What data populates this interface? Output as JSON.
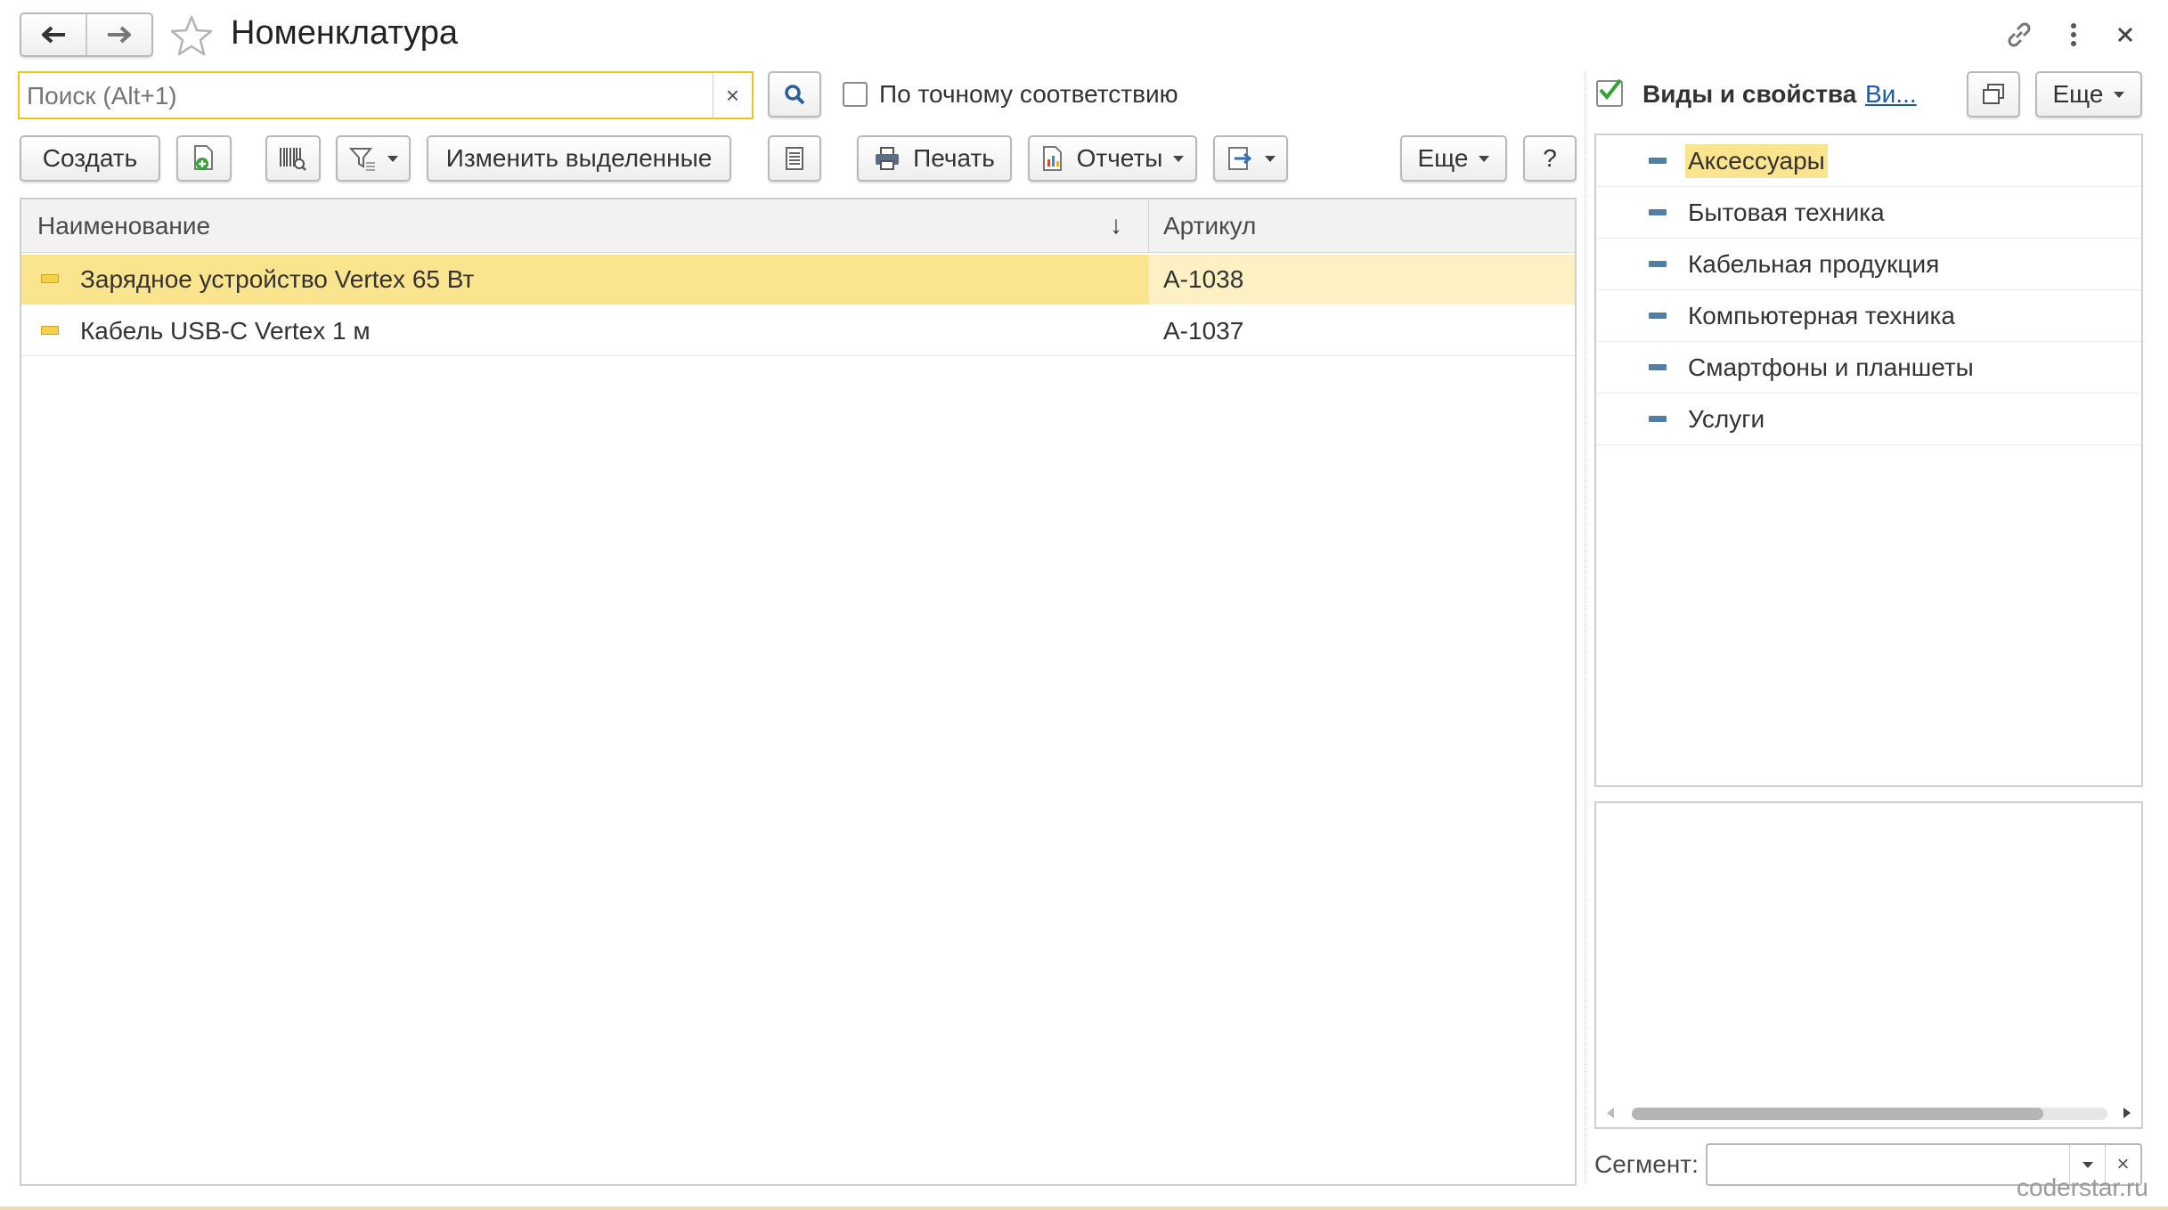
{
  "window": {
    "title": "Номенклатура",
    "back_icon": "arrow-left-icon",
    "forward_icon": "arrow-right-icon",
    "favorite_icon": "star-icon",
    "link_icon": "link-icon",
    "menu_icon": "vertical-dots-icon",
    "close_icon": "close-icon"
  },
  "search": {
    "placeholder": "Поиск (Alt+1)",
    "value": "",
    "clear_label": "×",
    "exact_match_label": "По точному соответствию",
    "exact_match_checked": false
  },
  "toolbar": {
    "create_label": "Создать",
    "change_selected_label": "Изменить выделенные",
    "print_label": "Печать",
    "reports_label": "Отчеты",
    "more_label": "Еще",
    "help_label": "?"
  },
  "table": {
    "columns": [
      "Наименование",
      "Артикул"
    ],
    "sort_indicator": "↓",
    "rows": [
      {
        "name": "Зарядное устройство Vertex 65 Вт",
        "sku": "А-1038",
        "selected": true
      },
      {
        "name": "Кабель USB-C Vertex 1 м",
        "sku": "А-1037",
        "selected": false
      }
    ]
  },
  "side_panel": {
    "checkbox_checked": true,
    "title": "Виды и свойства",
    "link": "Ви...",
    "more_label": "Еще",
    "items": [
      {
        "label": "Аксессуары",
        "selected": true
      },
      {
        "label": "Бытовая техника",
        "selected": false
      },
      {
        "label": "Кабельная продукция",
        "selected": false
      },
      {
        "label": "Компьютерная техника",
        "selected": false
      },
      {
        "label": "Смартфоны и планшеты",
        "selected": false
      },
      {
        "label": "Услуги",
        "selected": false
      }
    ],
    "segment_label": "Сегмент:",
    "segment_value": "",
    "segment_clear": "×"
  },
  "watermark": "coderstar.ru",
  "colors": {
    "selection": "#fae48e",
    "selection_light": "#fdf1c4",
    "accent_link": "#1d5aa8",
    "check_green": "#33a133",
    "search_border": "#f0c419"
  }
}
